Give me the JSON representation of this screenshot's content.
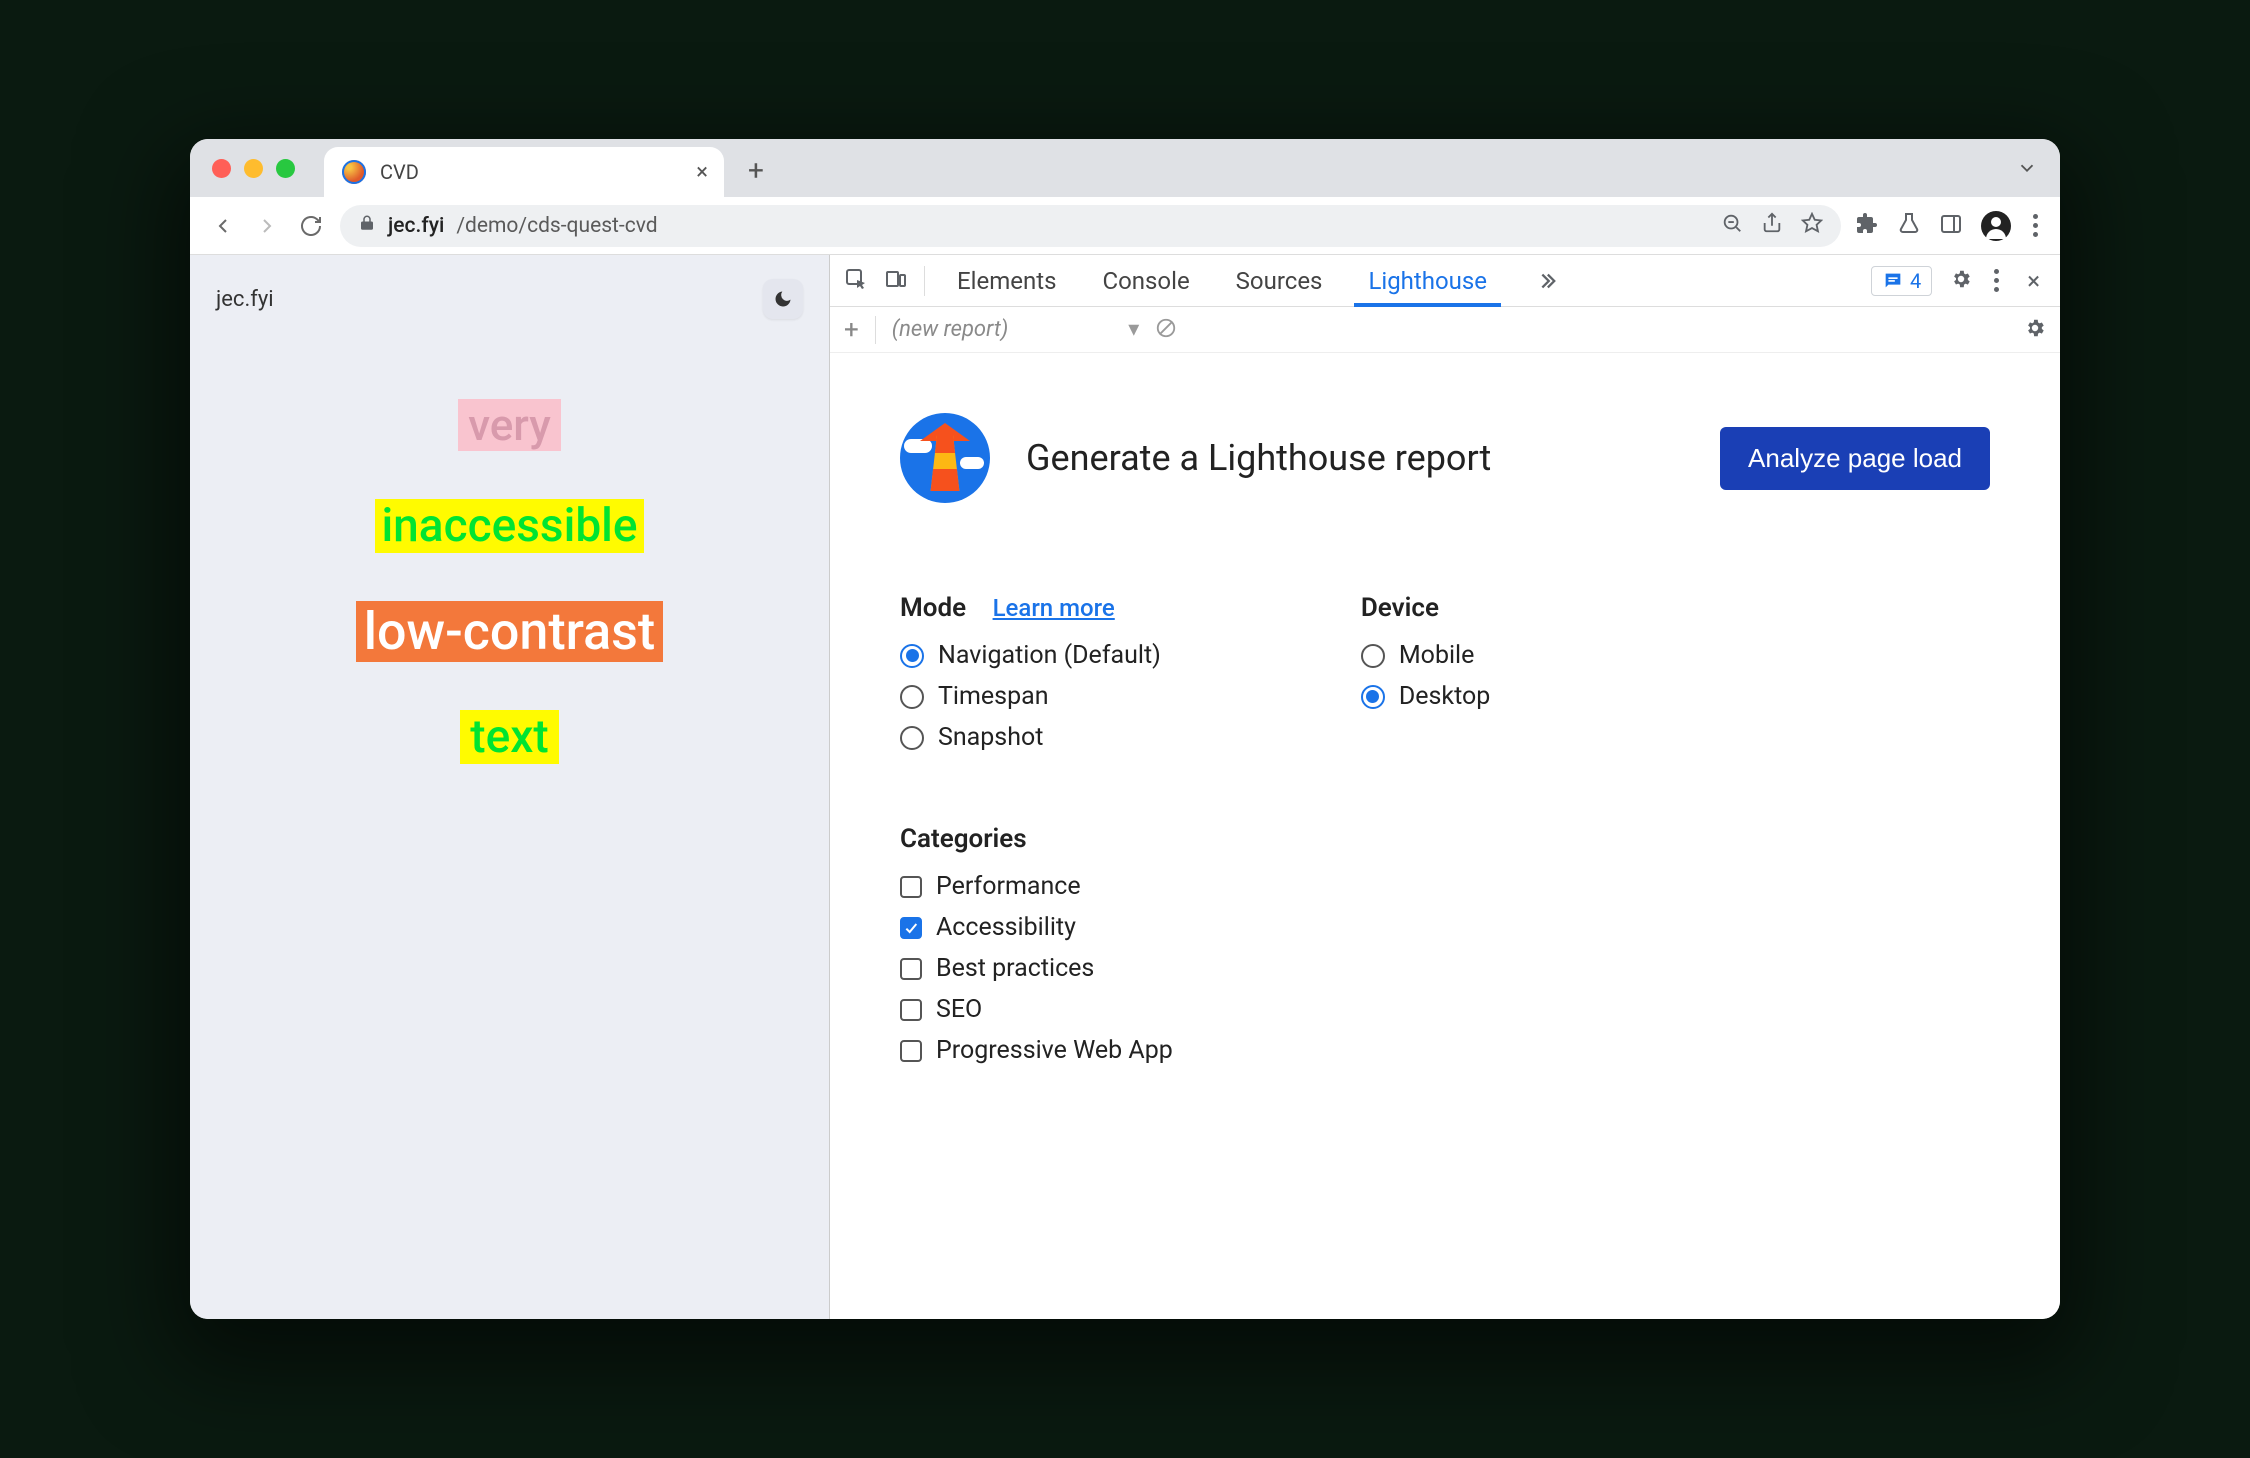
{
  "browser": {
    "tab_title": "CVD",
    "url_host": "jec.fyi",
    "url_path": "/demo/cds-quest-cvd"
  },
  "page": {
    "brand": "jec.fyi",
    "words": [
      "very",
      "inaccessible",
      "low-contrast",
      "text"
    ]
  },
  "devtools": {
    "tabs": [
      "Elements",
      "Console",
      "Sources",
      "Lighthouse"
    ],
    "active_tab": "Lighthouse",
    "issues_count": "4",
    "subbar_report_label": "(new report)"
  },
  "lighthouse": {
    "title": "Generate a Lighthouse report",
    "analyze_button": "Analyze page load",
    "mode": {
      "heading": "Mode",
      "learn_more": "Learn more",
      "options": [
        {
          "label": "Navigation (Default)",
          "selected": true
        },
        {
          "label": "Timespan",
          "selected": false
        },
        {
          "label": "Snapshot",
          "selected": false
        }
      ]
    },
    "device": {
      "heading": "Device",
      "options": [
        {
          "label": "Mobile",
          "selected": false
        },
        {
          "label": "Desktop",
          "selected": true
        }
      ]
    },
    "categories": {
      "heading": "Categories",
      "options": [
        {
          "label": "Performance",
          "checked": false
        },
        {
          "label": "Accessibility",
          "checked": true
        },
        {
          "label": "Best practices",
          "checked": false
        },
        {
          "label": "SEO",
          "checked": false
        },
        {
          "label": "Progressive Web App",
          "checked": false
        }
      ]
    }
  }
}
